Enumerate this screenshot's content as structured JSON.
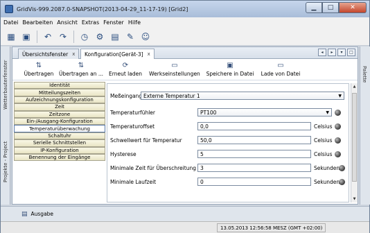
{
  "window": {
    "title": "GridVis-999.2087.0-SNAPSHOT(2013-04-29_11-17-19) [Grid2]"
  },
  "menu": [
    "Datei",
    "Bearbeiten",
    "Ansicht",
    "Extras",
    "Fenster",
    "Hilfe"
  ],
  "left_panels": [
    "Wetterbauterfenster",
    "Projekte - Project"
  ],
  "right_panel": "Palette",
  "tabs": [
    {
      "label": "Übersichtsfenster",
      "close": "x"
    },
    {
      "label": "Konfiguration[Gerät-3]",
      "close": "x"
    }
  ],
  "actions": [
    {
      "label": "Übertragen",
      "icon": "transfer-icon"
    },
    {
      "label": "Übertragen an ...",
      "icon": "transfer-to-icon"
    },
    {
      "label": "Erneut laden",
      "icon": "reload-icon"
    },
    {
      "label": "Werkseinstellungen",
      "icon": "factory-settings-icon"
    },
    {
      "label": "Speichere in Datei",
      "icon": "save-file-icon"
    },
    {
      "label": "Lade von Datei",
      "icon": "load-file-icon"
    }
  ],
  "nav": [
    "Identität",
    "Mitteilungszeiten",
    "Aufzeichnungskonfiguration",
    "Zeit",
    "Zeitzone",
    "Ein-/Ausgang-Konfiguration",
    "Temperaturüberwachung",
    "Schaltuhr",
    "Serielle Schnittstellen",
    "IP-Konfiguration",
    "Benennung der Eingänge"
  ],
  "active_nav": "Temperaturüberwachung",
  "form": {
    "input_label": "Meßeingang",
    "input_value": "Externe Temperatur 1",
    "sensor_label": "Temperaturfühler",
    "sensor_value": "PT100",
    "offset_label": "Temperaturoffset",
    "offset_value": "0,0",
    "offset_unit": "Celsius",
    "threshold_label": "Schwellwert für Temperatur",
    "threshold_value": "50,0",
    "threshold_unit": "Celsius",
    "hysteresis_label": "Hysterese",
    "hysteresis_value": "5",
    "hysteresis_unit": "Celsius",
    "minexceed_label": "Minimale Zeit für Überschreitung",
    "minexceed_value": "3",
    "minexceed_unit": "Sekunden",
    "minrun_label": "Minimale Laufzeit",
    "minrun_value": "0",
    "minrun_unit": "Sekunden"
  },
  "output_label": "Ausgabe",
  "status_time": "13.05.2013 12:56:58 MESZ (GMT +02:00)"
}
